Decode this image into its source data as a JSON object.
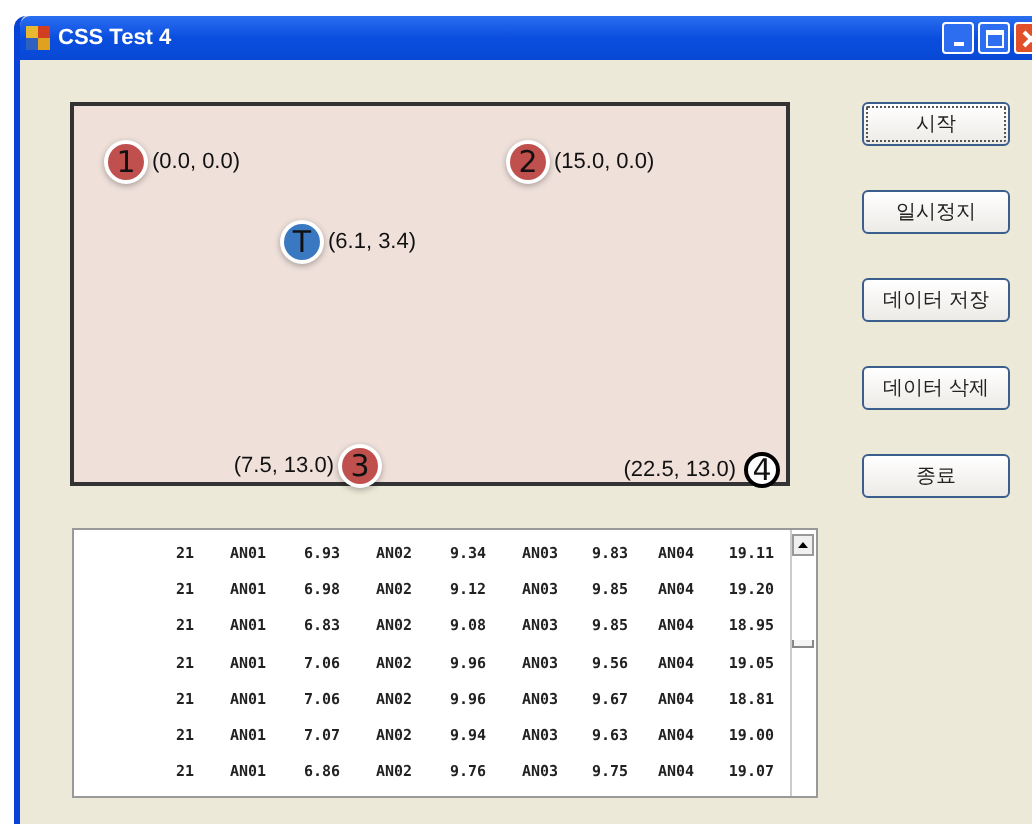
{
  "window": {
    "title": "CSS Test 4"
  },
  "canvas": {
    "markers": [
      {
        "label": "1",
        "coord": "(0.0, 0.0)",
        "kind": "filled",
        "color": "#c0504d"
      },
      {
        "label": "2",
        "coord": "(15.0, 0.0)",
        "kind": "filled",
        "color": "#c0504d"
      },
      {
        "label": "T",
        "coord": "(6.1, 3.4)",
        "kind": "filled",
        "color": "#3b78c2"
      },
      {
        "label": "3",
        "coord": "(7.5, 13.0)",
        "kind": "filled",
        "color": "#c0504d"
      },
      {
        "label": "4",
        "coord": "(22.5, 13.0)",
        "kind": "outline",
        "color": "#ffffff"
      }
    ]
  },
  "buttons": [
    {
      "label": "시작",
      "focused": true
    },
    {
      "label": "일시정지",
      "focused": false
    },
    {
      "label": "데이터 저장",
      "focused": false
    },
    {
      "label": "데이터 삭제",
      "focused": false
    },
    {
      "label": "종료",
      "focused": false
    }
  ],
  "list": {
    "rows": [
      [
        "21",
        "AN01",
        "6.93",
        "AN02",
        "9.34",
        "AN03",
        "9.83",
        "AN04",
        "19.11"
      ],
      [
        "21",
        "AN01",
        "6.98",
        "AN02",
        "9.12",
        "AN03",
        "9.85",
        "AN04",
        "19.20"
      ],
      [
        "21",
        "AN01",
        "6.83",
        "AN02",
        "9.08",
        "AN03",
        "9.85",
        "AN04",
        "18.95"
      ],
      [
        "21",
        "AN01",
        "7.06",
        "AN02",
        "9.96",
        "AN03",
        "9.56",
        "AN04",
        "19.05"
      ],
      [
        "21",
        "AN01",
        "7.06",
        "AN02",
        "9.96",
        "AN03",
        "9.67",
        "AN04",
        "18.81"
      ],
      [
        "21",
        "AN01",
        "7.07",
        "AN02",
        "9.94",
        "AN03",
        "9.63",
        "AN04",
        "19.00"
      ],
      [
        "21",
        "AN01",
        "6.86",
        "AN02",
        "9.76",
        "AN03",
        "9.75",
        "AN04",
        "19.07"
      ]
    ]
  }
}
